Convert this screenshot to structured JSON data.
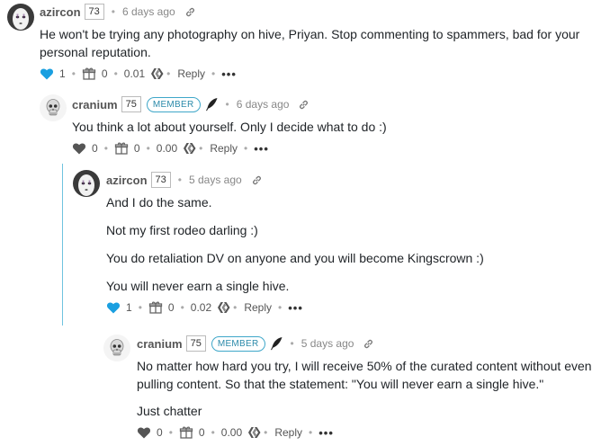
{
  "comments": [
    {
      "author": "azircon",
      "rep": "73",
      "time": "6 days ago",
      "text": [
        "He won't be trying any photography on hive, Priyan. Stop commenting to spammers, bad for your",
        "personal reputation."
      ],
      "votes": "1",
      "gifts": "0",
      "payout": "0.01",
      "reply_label": "Reply",
      "voted": true
    },
    {
      "author": "cranium",
      "rep": "75",
      "badge": "MEMBER",
      "time": "6 days ago",
      "text": [
        "You think a lot about yourself. Only I decide what to do :)"
      ],
      "votes": "0",
      "gifts": "0",
      "payout": "0.00",
      "reply_label": "Reply",
      "voted": false
    },
    {
      "author": "azircon",
      "rep": "73",
      "time": "5 days ago",
      "text": [
        "And I do the same.",
        "Not my first rodeo darling :)",
        "You do retaliation DV on anyone and you will become Kingscrown :)",
        "You will never earn a single hive."
      ],
      "votes": "1",
      "gifts": "0",
      "payout": "0.02",
      "reply_label": "Reply",
      "voted": true
    },
    {
      "author": "cranium",
      "rep": "75",
      "badge": "MEMBER",
      "time": "5 days ago",
      "text": [
        "No matter how hard you try, I will receive 50% of the curated content without even",
        "pulling content. So that the statement: \"You will never earn a single hive.\"",
        "Just chatter"
      ],
      "votes": "0",
      "gifts": "0",
      "payout": "0.00",
      "reply_label": "Reply",
      "voted": false
    }
  ],
  "colors": {
    "voted": "#1a9fe0",
    "unvoted": "#555555",
    "badge": "#2b8aaa",
    "thread_line": "#6fc3df"
  }
}
